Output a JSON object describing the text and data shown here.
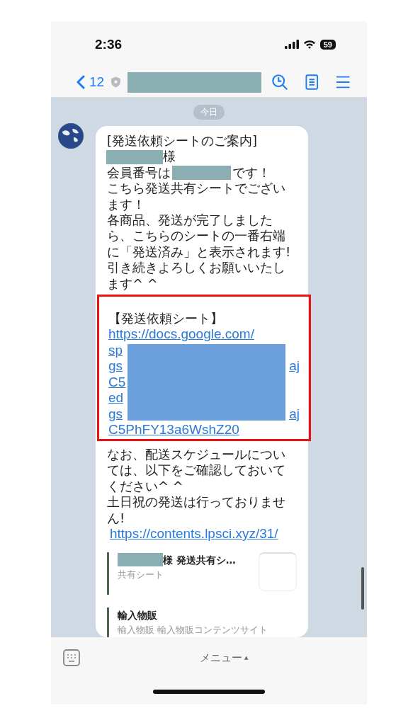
{
  "status_bar": {
    "time": "2:36",
    "battery": "59"
  },
  "nav": {
    "back_count": "12"
  },
  "date_chip": "今日",
  "message": {
    "heading": "[発送依頼シートのご案内]",
    "honorific": "様",
    "member_prefix": "会員番号は",
    "member_suffix": "です！",
    "body": [
      "こちら発送共有シートでござい",
      "ます！",
      "各商品、発送が完了しました",
      "ら、こちらのシートの一番右端",
      "に「発送済み」と表示されます!",
      "引き続きよろしくお願いいたし",
      "ます^ ^"
    ],
    "link_block": {
      "highlighted": true,
      "title": "【発送依頼シート】",
      "lines": [
        {
          "left": "https://docs.google.com/"
        },
        {
          "left": "sp"
        },
        {
          "left": "gs",
          "right": "aj"
        },
        {
          "left": "C5"
        },
        {
          "left": "ed"
        },
        {
          "left": "gs",
          "right": "aj"
        },
        {
          "left": "C5PhFY13a6WshZ20"
        }
      ]
    },
    "after": [
      "なお、配送スケジュールについ",
      "ては、以下をご確認しておいて",
      "ください^ ^",
      "土日祝の発送は行っておりませ",
      "ん!"
    ],
    "link": "https://contents.lpsci.xyz/31/",
    "previews": [
      {
        "kind": "thumb",
        "title": "様 発送共有シ…",
        "subtitle": "共有シート"
      },
      {
        "kind": "plain",
        "title": "輸入物販",
        "subtitle": "輸入物販 輸入物販コンテンツサイト"
      }
    ]
  },
  "footer": {
    "menu": "メニュー",
    "caret": "▲"
  }
}
